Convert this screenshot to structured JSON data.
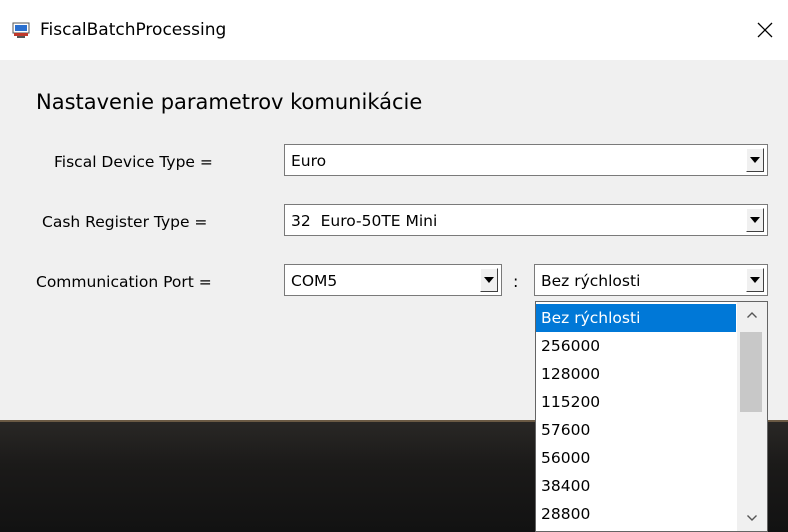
{
  "window": {
    "title": "FiscalBatchProcessing",
    "icon": "app-monitor-icon",
    "close_glyph": "✕"
  },
  "form": {
    "heading": "Nastavenie parametrov komunikácie",
    "fiscal_device_type": {
      "label": "Fiscal Device Type =",
      "value": "Euro"
    },
    "cash_register_type": {
      "label": "Cash Register Type =",
      "value": "32  Euro-50TE Mini"
    },
    "communication_port": {
      "label": "Communication Port =",
      "port_value": "COM5",
      "separator": ":",
      "speed_value": "Bez rýchlosti"
    }
  },
  "speed_dropdown": {
    "options": [
      "Bez rýchlosti",
      "256000",
      "128000",
      "115200",
      "57600",
      "56000",
      "38400",
      "28800"
    ],
    "selected_index": 0
  },
  "colors": {
    "selection": "#0078d7",
    "window_bg": "#f0f0f0"
  }
}
